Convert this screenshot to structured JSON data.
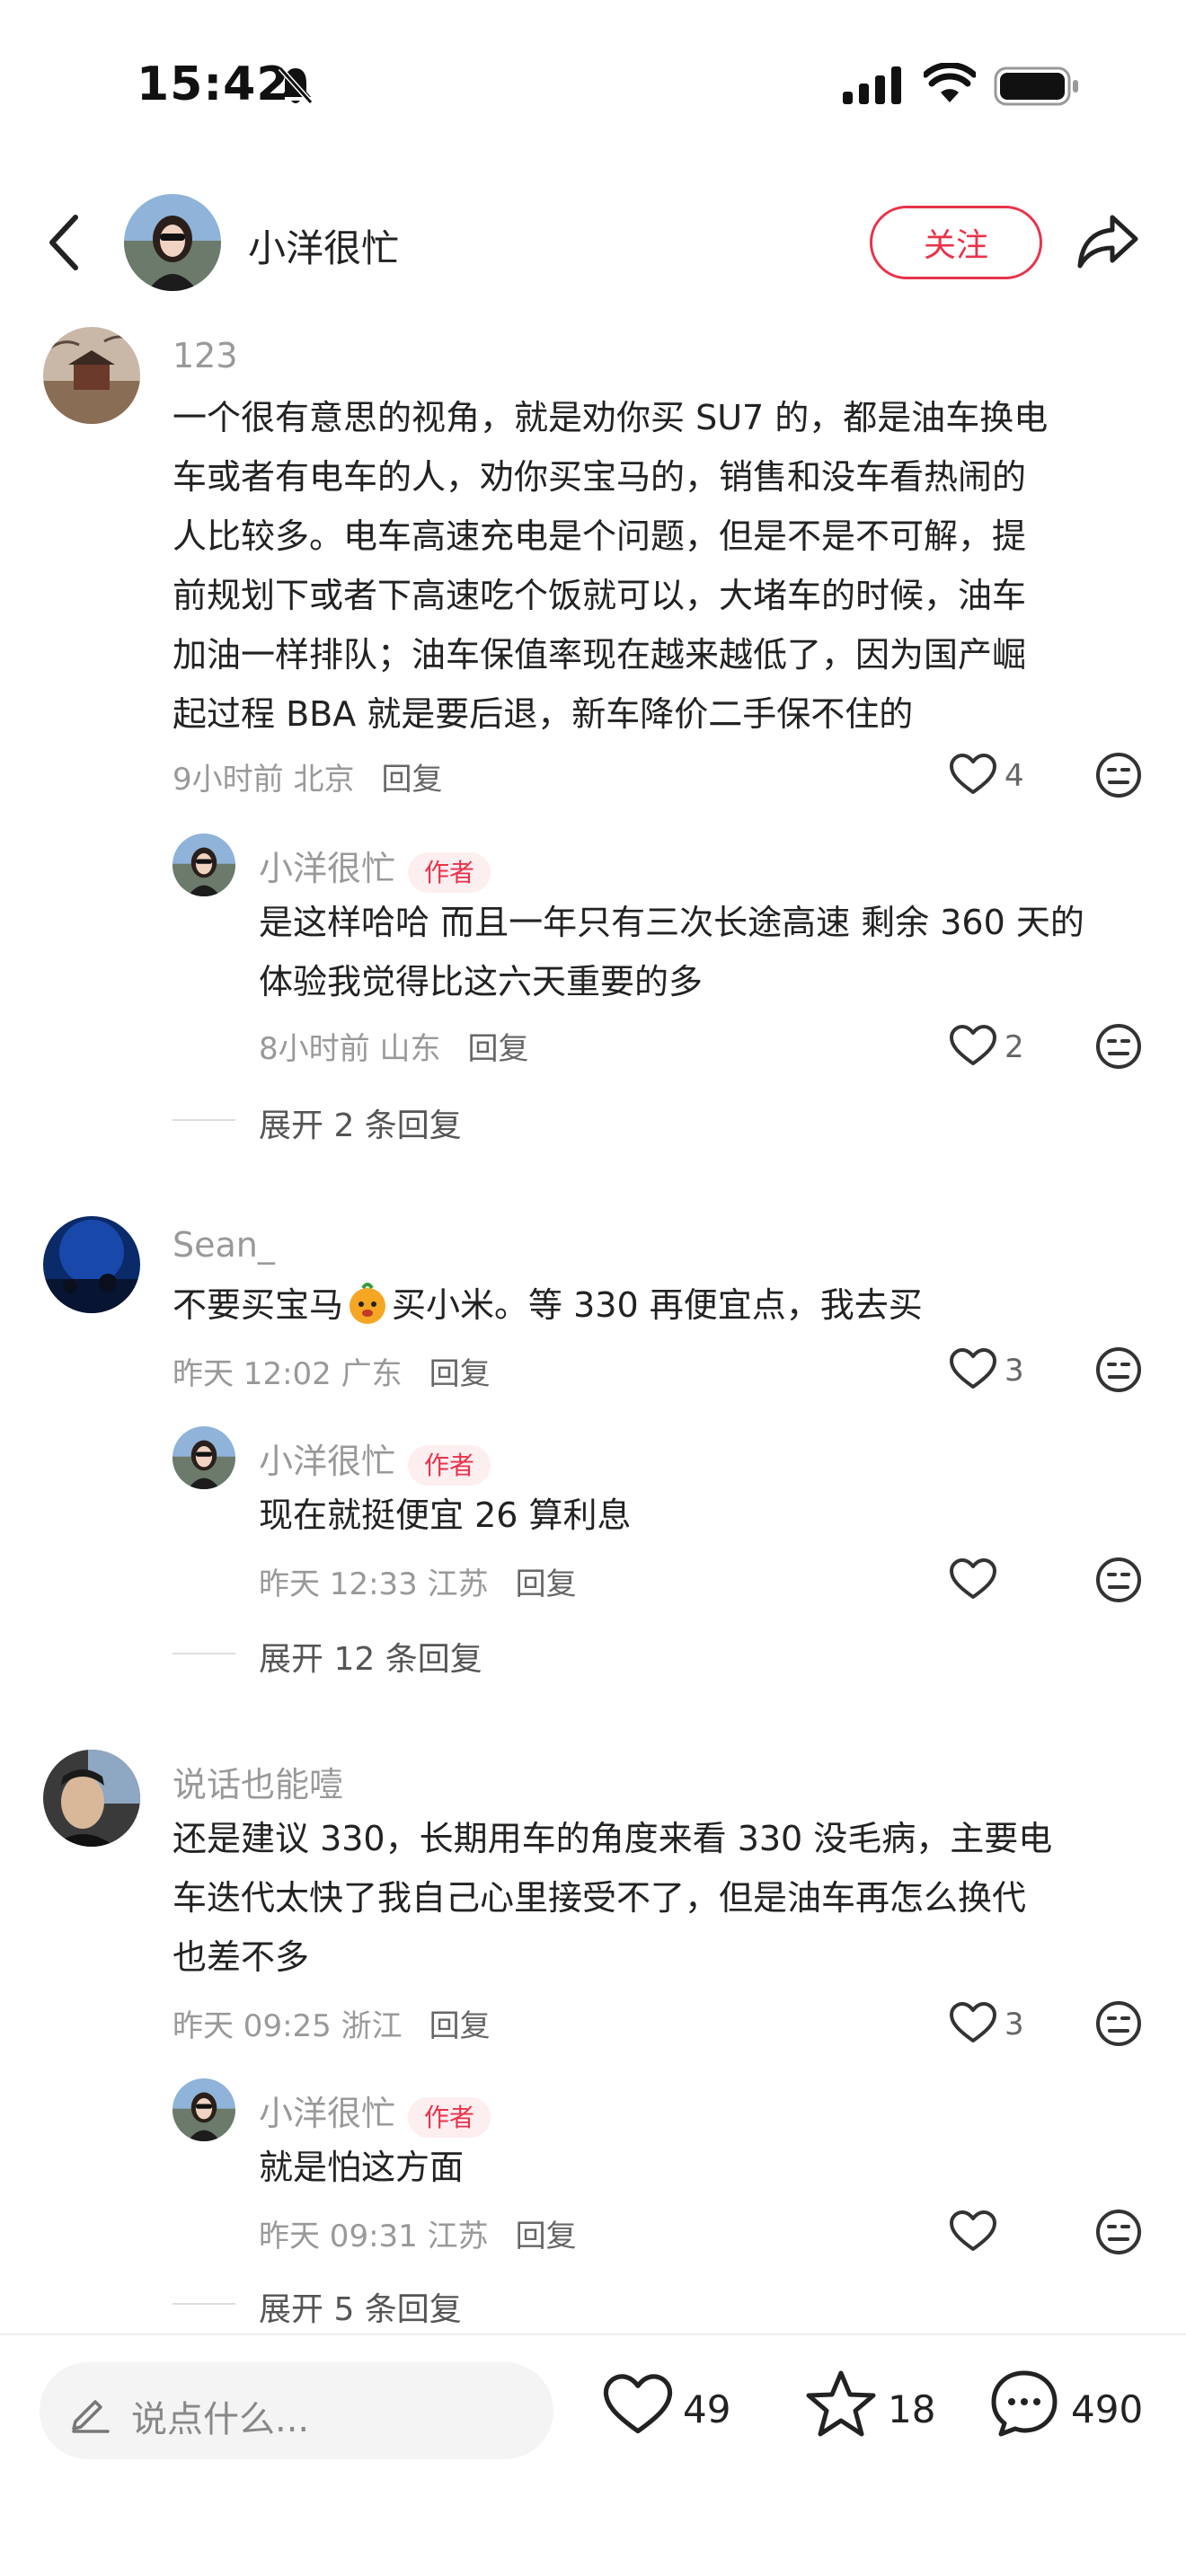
{
  "status_bar": {
    "time": "15:42"
  },
  "header": {
    "title": "小洋很忙",
    "follow_label": "关注"
  },
  "comments": [
    {
      "user": "123",
      "text_lines": [
        "一个很有意思的视角，就是劝你买 SU7 的，都是油车换电",
        "车或者有电车的人，劝你买宝马的，销售和没车看热闹的",
        "人比较多。电车高速充电是个问题，但是不是不可解，提",
        "前规划下或者下高速吃个饭就可以，大堵车的时候，油车",
        "加油一样排队；油车保值率现在越来越低了，因为国产崛",
        "起过程 BBA 就是要后退，新车降价二手保不住的"
      ],
      "meta": "9小时前  北京",
      "reply_label": "回复",
      "likes": "4",
      "author_reply": {
        "user": "小洋很忙",
        "badge": "作者",
        "text_lines": [
          "是这样哈哈 而且一年只有三次长途高速 剩余 360 天的",
          "体验我觉得比这六天重要的多"
        ],
        "meta": "8小时前  山东",
        "reply_label": "回复",
        "likes": "2"
      },
      "expand": "展开 2 条回复"
    },
    {
      "user": "Sean_",
      "text_a": "不要买宝马",
      "text_b": "买小米。等 330 再便宜点，我去买",
      "meta": "昨天 12:02  广东",
      "reply_label": "回复",
      "likes": "3",
      "author_reply": {
        "user": "小洋很忙",
        "badge": "作者",
        "text_lines": [
          "现在就挺便宜 26 算利息"
        ],
        "meta": "昨天 12:33  江苏",
        "reply_label": "回复",
        "likes": ""
      },
      "expand": "展开 12 条回复"
    },
    {
      "user": "说话也能噎",
      "text_lines": [
        "还是建议 330，长期用车的角度来看 330 没毛病，主要电",
        "车迭代太快了我自己心里接受不了，但是油车再怎么换代",
        "也差不多"
      ],
      "meta": "昨天 09:25  浙江",
      "reply_label": "回复",
      "likes": "3",
      "author_reply": {
        "user": "小洋很忙",
        "badge": "作者",
        "text_lines": [
          "就是怕这方面"
        ],
        "meta": "昨天 09:31  江苏",
        "reply_label": "回复",
        "likes": ""
      },
      "expand": "展开 5 条回复"
    }
  ],
  "bottom_bar": {
    "placeholder": "说点什么...",
    "likes": "49",
    "stars": "18",
    "comments": "490"
  },
  "colors": {
    "accent": "#e8334a",
    "muted": "#999999"
  },
  "icons": [
    "back-icon",
    "share-icon",
    "heart-icon",
    "dislike-face-icon",
    "pencil-icon",
    "star-icon",
    "comment-bubble-icon",
    "emoji-icon",
    "signal-icon",
    "wifi-icon",
    "battery-icon",
    "mute-bell-icon"
  ]
}
